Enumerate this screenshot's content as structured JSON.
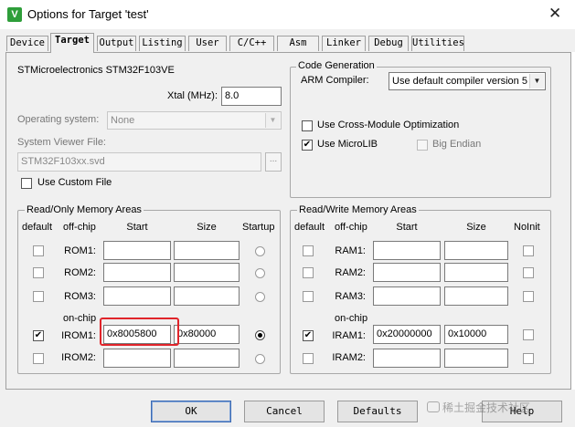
{
  "window": {
    "title": "Options for Target 'test'",
    "icon": "keil-uvision-icon"
  },
  "tabs": [
    {
      "label": "Device",
      "active": false
    },
    {
      "label": "Target",
      "active": true
    },
    {
      "label": "Output",
      "active": false
    },
    {
      "label": "Listing",
      "active": false
    },
    {
      "label": "User",
      "active": false
    },
    {
      "label": "C/C++",
      "active": false
    },
    {
      "label": "Asm",
      "active": false
    },
    {
      "label": "Linker",
      "active": false
    },
    {
      "label": "Debug",
      "active": false
    },
    {
      "label": "Utilities",
      "active": false
    }
  ],
  "device": {
    "name": "STMicroelectronics STM32F103VE",
    "xtal_label": "Xtal (MHz):",
    "xtal_value": "8.0",
    "os_label": "Operating system:",
    "os_value": "None",
    "svf_label": "System Viewer File:",
    "svf_value": "STM32F103xx.svd",
    "browse_label": "...",
    "custom_file_label": "Use Custom File",
    "custom_file_checked": false
  },
  "codegen": {
    "group_label": "Code Generation",
    "compiler_label": "ARM Compiler:",
    "compiler_value": "Use default compiler version 5",
    "cross_module_label": "Use Cross-Module Optimization",
    "cross_module_checked": false,
    "microlib_label": "Use MicroLIB",
    "microlib_checked": true,
    "big_endian_label": "Big Endian",
    "big_endian_checked": false
  },
  "rom": {
    "group_label": "Read/Only Memory Areas",
    "headers": {
      "default": "default",
      "offchip": "off-chip",
      "start": "Start",
      "size": "Size",
      "startup": "Startup"
    },
    "onchip_label": "on-chip",
    "rows": [
      {
        "label": "ROM1:",
        "start": "",
        "size": "",
        "default": false,
        "startup": false
      },
      {
        "label": "ROM2:",
        "start": "",
        "size": "",
        "default": false,
        "startup": false
      },
      {
        "label": "ROM3:",
        "start": "",
        "size": "",
        "default": false,
        "startup": false
      },
      {
        "label": "IROM1:",
        "start": "0x8005800",
        "size": "0x80000",
        "default": true,
        "startup": true
      },
      {
        "label": "IROM2:",
        "start": "",
        "size": "",
        "default": false,
        "startup": false
      }
    ]
  },
  "ram": {
    "group_label": "Read/Write Memory Areas",
    "headers": {
      "default": "default",
      "offchip": "off-chip",
      "start": "Start",
      "size": "Size",
      "noinit": "NoInit"
    },
    "onchip_label": "on-chip",
    "rows": [
      {
        "label": "RAM1:",
        "start": "",
        "size": "",
        "default": false,
        "noinit": false
      },
      {
        "label": "RAM2:",
        "start": "",
        "size": "",
        "default": false,
        "noinit": false
      },
      {
        "label": "RAM3:",
        "start": "",
        "size": "",
        "default": false,
        "noinit": false
      },
      {
        "label": "IRAM1:",
        "start": "0x20000000",
        "size": "0x10000",
        "default": true,
        "noinit": false
      },
      {
        "label": "IRAM2:",
        "start": "",
        "size": "",
        "default": false,
        "noinit": false
      }
    ]
  },
  "buttons": {
    "ok": "OK",
    "cancel": "Cancel",
    "defaults": "Defaults",
    "help": "Help"
  },
  "watermark": "稀土掘金技术社区",
  "colors": {
    "highlight": "#e0242a",
    "default_button_border": "#3d6bb3"
  }
}
